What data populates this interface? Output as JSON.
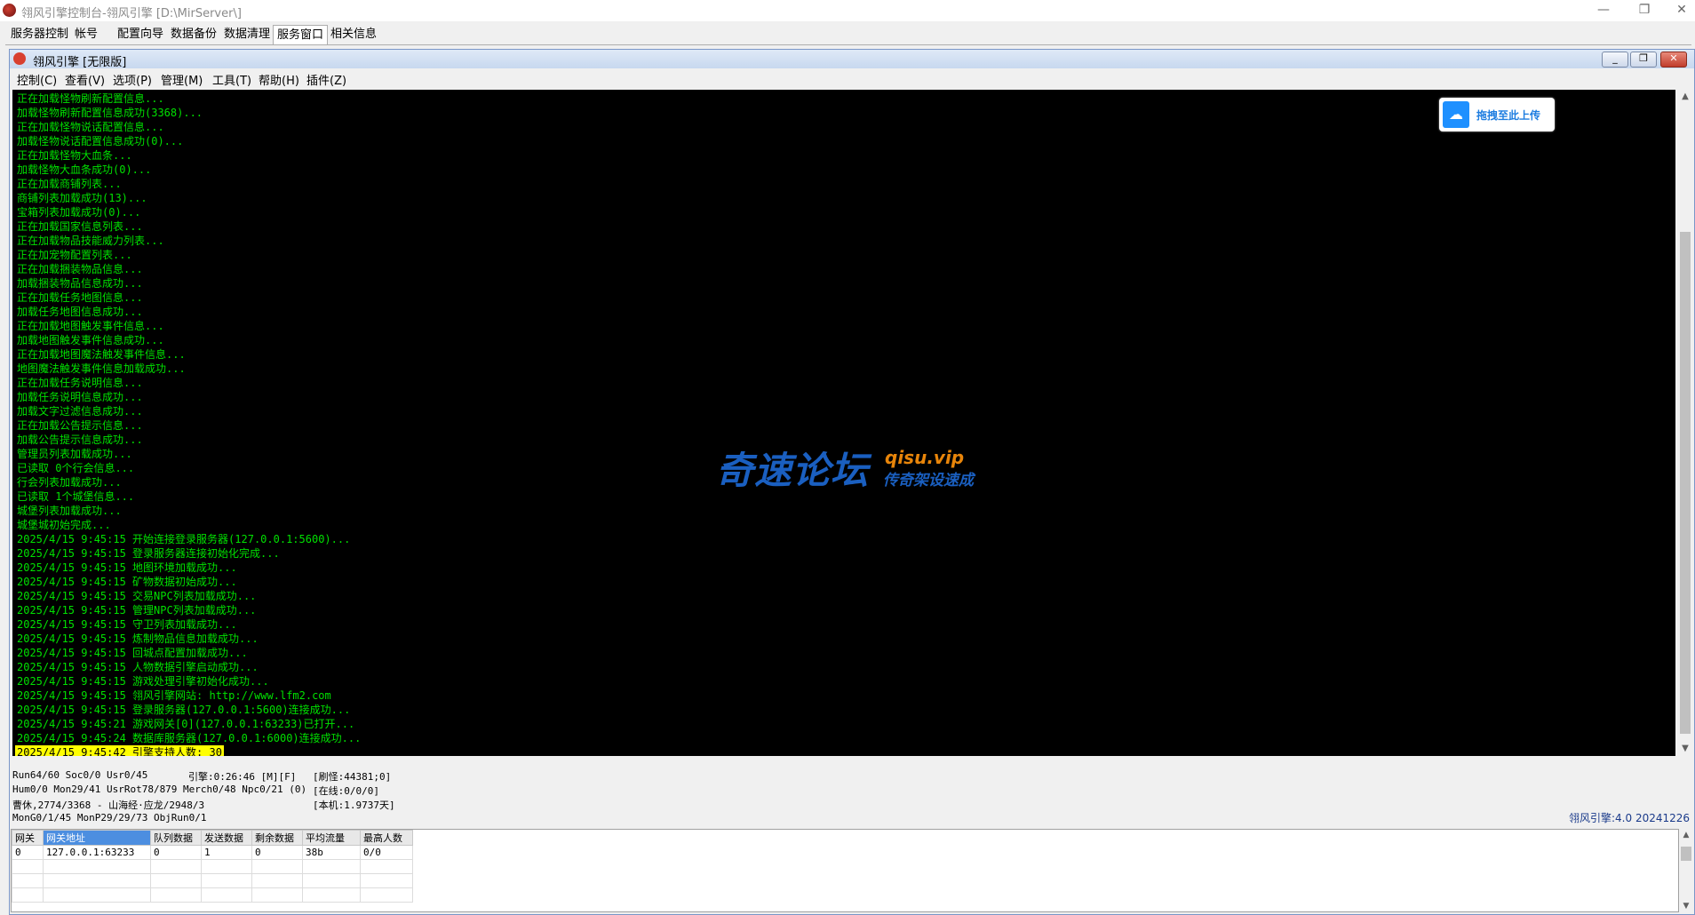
{
  "window": {
    "title": "翎风引擎控制台-翎风引擎 [D:\\MirServer\\]",
    "controls": [
      "—",
      "❐",
      "✕"
    ]
  },
  "tabs": [
    "服务器控制",
    "帐号",
    "配置向导",
    "数据备份",
    "数据清理",
    "服务窗口",
    "相关信息"
  ],
  "active_tab": "服务窗口",
  "inner": {
    "title": "翎风引擎 [无限版]",
    "menus": [
      "控制(C)",
      "查看(V)",
      "选项(P)",
      "管理(M)",
      "工具(T)",
      "帮助(H)",
      "插件(Z)"
    ]
  },
  "log": [
    "正在加载怪物刷新配置信息...",
    "加载怪物刷新配置信息成功(3368)...",
    "正在加载怪物说话配置信息...",
    "加载怪物说话配置信息成功(0)...",
    "正在加载怪物大血条...",
    "加载怪物大血条成功(0)...",
    "正在加载商铺列表...",
    "商铺列表加载成功(13)...",
    "宝箱列表加载成功(0)...",
    "正在加载国家信息列表...",
    "正在加载物品技能威力列表...",
    "正在加宠物配置列表...",
    "正在加载捆装物品信息...",
    "加载捆装物品信息成功...",
    "正在加载任务地图信息...",
    "加载任务地图信息成功...",
    "正在加载地图触发事件信息...",
    "加载地图触发事件信息成功...",
    "正在加载地图魔法触发事件信息...",
    "地图魔法触发事件信息加载成功...",
    "正在加载任务说明信息...",
    "加载任务说明信息成功...",
    "加载文字过滤信息成功...",
    "正在加载公告提示信息...",
    "加载公告提示信息成功...",
    "管理员列表加载成功...",
    "已读取 0个行会信息...",
    "行会列表加载成功...",
    "已读取 1个城堡信息...",
    "城堡列表加载成功...",
    "城堡城初始完成...",
    "2025/4/15 9:45:15 开始连接登录服务器(127.0.0.1:5600)...",
    "2025/4/15 9:45:15 登录服务器连接初始化完成...",
    "2025/4/15 9:45:15 地图环境加载成功...",
    "2025/4/15 9:45:15 矿物数据初始成功...",
    "2025/4/15 9:45:15 交易NPC列表加载成功...",
    "2025/4/15 9:45:15 管理NPC列表加载成功...",
    "2025/4/15 9:45:15 守卫列表加载成功...",
    "2025/4/15 9:45:15 炼制物品信息加载成功...",
    "2025/4/15 9:45:15 回城点配置加载成功...",
    "2025/4/15 9:45:15 人物数据引擎启动成功...",
    "2025/4/15 9:45:15 游戏处理引擎初始化成功...",
    "2025/4/15 9:45:15 翎风引擎网站: http://www.lfm2.com",
    "2025/4/15 9:45:15 登录服务器(127.0.0.1:5600)连接成功...",
    "2025/4/15 9:45:21 游戏网关[0](127.0.0.1:63233)已打开...",
    "2025/4/15 9:45:24 数据库服务器(127.0.0.1:6000)连接成功..."
  ],
  "log_highlight": "2025/4/15 9:45:42 引擎支持人数: 30",
  "upload_button": "拖拽至此上传",
  "watermark": {
    "main": "奇速论坛",
    "site": "qisu.vip",
    "slogan": "传奇架设速成"
  },
  "status": {
    "line1_a": "Run64/60 Soc0/0 Usr0/45",
    "line1_b": "引擎:0:26:46 [M][F]",
    "line1_c": "[刷怪:44381;0]",
    "line2_a": "Hum0/0 Mon29/41 UsrRot78/879 Merch0/48 Npc0/21 (0)",
    "line2_c": "[在线:0/0/0]",
    "line3_a": "曹休,2774/3368 - 山海经·应龙/2948/3",
    "line3_c": "[本机:1.9737天]",
    "line4_a": "MonG0/1/45 MonP29/29/73 ObjRun0/1",
    "version": "翎风引擎:4.0 20241226"
  },
  "gate_table": {
    "headers": [
      "网关",
      "网关地址",
      "队列数据",
      "发送数据",
      "剩余数据",
      "平均流量",
      "最高人数"
    ],
    "rows": [
      [
        "0",
        "127.0.0.1:63233",
        "0",
        "1",
        "0",
        "38b",
        "0/0"
      ]
    ]
  }
}
